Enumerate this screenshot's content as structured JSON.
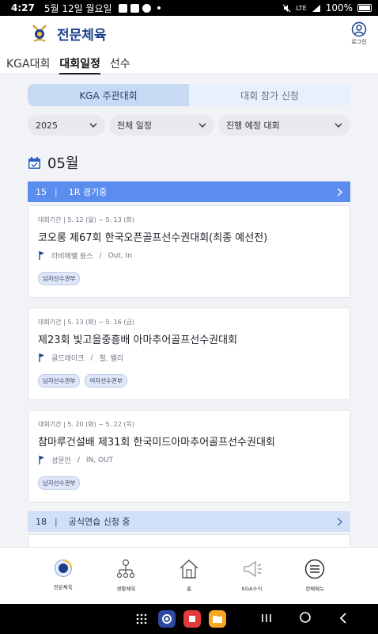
{
  "status_bar": {
    "time": "4:27",
    "date": "5월 12일 월요일",
    "battery": "100%",
    "network": "LTE"
  },
  "header": {
    "app_title": "전문체육",
    "login_label": "로그인"
  },
  "top_tabs": [
    {
      "label": "KGA대회",
      "active": false
    },
    {
      "label": "대회일정",
      "active": true
    },
    {
      "label": "선수",
      "active": false
    }
  ],
  "segment": {
    "left": "KGA 주관대회",
    "right": "대회 참가 신청"
  },
  "filters": {
    "year": "2025",
    "schedule": "전체 일정",
    "status": "진행 예정 대회"
  },
  "month": {
    "label": "05월"
  },
  "groups": [
    {
      "day": "15",
      "sep": "|",
      "status": "1R 경기중"
    },
    {
      "day": "18",
      "sep": "|",
      "status": "공식연습 신청 중"
    }
  ],
  "events": [
    {
      "period": "대회기간 | 5. 12 (월) ~ 5. 13 (화)",
      "title": "코오롱 제67회 한국오픈골프선수권대회(최종 예선전)",
      "venue": "라비에벨 듄스",
      "course_sep": "/",
      "course": "Out, In",
      "badges": [
        "남자선수권부"
      ]
    },
    {
      "period": "대회기간 | 5. 13 (화) ~ 5. 16 (금)",
      "title": "제23회 빛고을중흥배 아마추어골프선수권대회",
      "venue": "골드레이크",
      "course_sep": "/",
      "course": "힐, 밸리",
      "badges": [
        "남자선수권부",
        "여자선수권부"
      ]
    },
    {
      "period": "대회기간 | 5. 20 (화) ~ 5. 22 (목)",
      "title": "참마루건설배 제31회 한국미드아마추어골프선수권대회",
      "venue": "성문안",
      "course_sep": "/",
      "course": "IN, OUT",
      "badges": [
        "남자선수권부"
      ]
    }
  ],
  "bottom_nav": [
    {
      "label": "전문체육",
      "icon": "pro-sports-icon"
    },
    {
      "label": "생활체육",
      "icon": "life-sports-icon"
    },
    {
      "label": "홈",
      "icon": "home-icon"
    },
    {
      "label": "KGA소식",
      "icon": "megaphone-icon"
    },
    {
      "label": "전체메뉴",
      "icon": "menu-icon"
    }
  ],
  "colors": {
    "brand": "#1c3f8c",
    "active_bar": "#5b8def",
    "light_bar": "#d2e0f7",
    "segment_active": "#c7daf4"
  }
}
